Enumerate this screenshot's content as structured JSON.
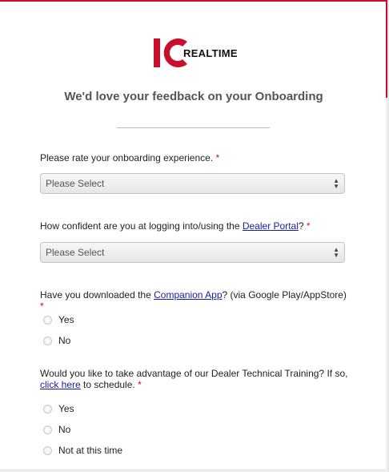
{
  "brand": {
    "logo_text": "REALTIME",
    "logo_mark": "IC",
    "accent": "#c8102e"
  },
  "heading": "We'd love your feedback on your Onboarding",
  "q1": {
    "text": "Please rate your onboarding experience. ",
    "required": "*",
    "select_value": "Please Select"
  },
  "q2": {
    "prefix": "How confident are you at logging into/using the ",
    "link": "Dealer Portal",
    "suffix": "? ",
    "required": "*",
    "select_value": "Please Select"
  },
  "q3": {
    "prefix": "Have you downloaded the ",
    "link": "Companion App",
    "suffix": "? (via Google Play/AppStore) ",
    "required": "*",
    "options": [
      "Yes",
      "No"
    ]
  },
  "q4": {
    "prefix": "Would you like to take advantage of our Dealer Technical Training? If so, ",
    "link": "click here",
    "suffix": " to schedule.  ",
    "required": "*",
    "options": [
      "Yes",
      "No",
      "Not at this time"
    ]
  }
}
